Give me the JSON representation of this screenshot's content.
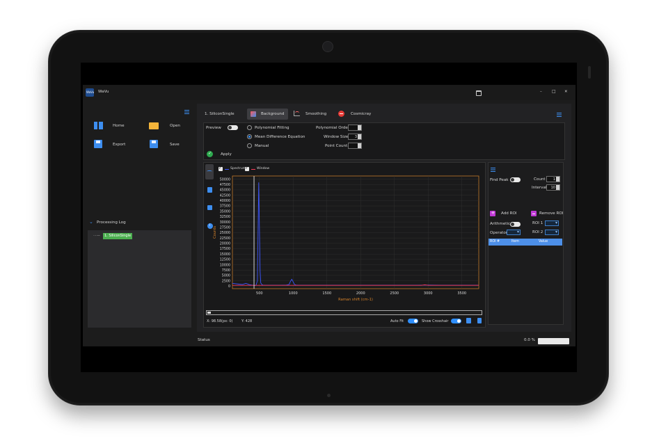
{
  "window": {
    "title": "WaVu",
    "logo_text": "WaVu",
    "minimize": "–",
    "maximize": "□",
    "close": "✕"
  },
  "sidebar": {
    "home": "Home",
    "open": "Open",
    "export": "Export",
    "save": "Save",
    "log_title": "Processing Log",
    "log_item": "1. SiliconSingle"
  },
  "toolbar": {
    "file_label": "1. SiliconSingle",
    "tab_background": "Background",
    "tab_smoothing": "Smoothing",
    "tab_cosmicray": "Cosmicray"
  },
  "settings": {
    "preview_label": "Preview",
    "radio_poly": "Polynomial Fitting",
    "radio_mean": "Mean Difference Equation",
    "radio_manual": "Manual",
    "poly_order_label": "Polynomial Order",
    "poly_order_value": "",
    "window_size_label": "Window Size",
    "window_size_value": "3",
    "point_count_label": "Point Count",
    "point_count_value": "",
    "apply_label": "Apply"
  },
  "plot": {
    "legend_spectrum": "Spectrum",
    "legend_window": "Window",
    "coord_x": "X: 98.58(px: 0)",
    "coord_y": "Y: 428",
    "auto_fit": "Auto Fit",
    "show_crosshair": "Show Crosshair",
    "colors": {
      "spectrum": "#3b55ff",
      "window_line": "#ff3b5b",
      "axes": "#c57a2a",
      "cursor": "#e8e8e8",
      "axis_label": "#d8832a"
    }
  },
  "chart_data": {
    "type": "line",
    "xlabel": "Raman shift (cm-1)",
    "ylabel": "Counts",
    "xlim": [
      100,
      3750
    ],
    "ylim": [
      -1200,
      51500
    ],
    "x_ticks": [
      500,
      1000,
      1500,
      2000,
      2500,
      3000,
      3500
    ],
    "y_ticks": [
      0,
      2500,
      5000,
      7500,
      10000,
      12500,
      15000,
      17500,
      20000,
      22500,
      25000,
      27500,
      30000,
      32500,
      35000,
      37500,
      40000,
      42500,
      45000,
      47500,
      50000
    ],
    "grid": true,
    "cursor_x": 420,
    "series": [
      {
        "name": "Spectrum",
        "x": [
          100,
          150,
          200,
          250,
          300,
          350,
          400,
          430,
          450,
          470,
          490,
          510,
          520,
          540,
          560,
          600,
          650,
          700,
          800,
          900,
          940,
          960,
          980,
          1000,
          1020,
          1040,
          1080,
          1200,
          1400,
          1600,
          1800,
          2000,
          2200,
          2400,
          2600,
          2800,
          3000,
          3200,
          3400,
          3600,
          3750
        ],
        "y": [
          1300,
          1100,
          900,
          800,
          1300,
          700,
          400,
          300,
          400,
          2500,
          48500,
          7000,
          1500,
          600,
          400,
          400,
          400,
          400,
          400,
          500,
          800,
          2200,
          3200,
          2000,
          800,
          500,
          400,
          400,
          400,
          400,
          400,
          400,
          400,
          400,
          400,
          400,
          500,
          400,
          400,
          400,
          400
        ]
      },
      {
        "name": "Window",
        "x": [
          100,
          500,
          1000,
          1500,
          2000,
          2500,
          2900,
          2950,
          3000,
          3500,
          3750
        ],
        "y": [
          350,
          350,
          360,
          360,
          350,
          350,
          360,
          600,
          360,
          350,
          350
        ]
      }
    ]
  },
  "peaks": {
    "find_peak": "Find Peak",
    "count_label": "Count",
    "count_value": "1",
    "interval_label": "Interval",
    "interval_value": "10",
    "add_roi": "Add ROI",
    "remove_roi": "Remove ROI",
    "arithmetic": "Arithmetic",
    "roi1": "ROI 1",
    "operator": "Operator",
    "roi2": "ROI 2",
    "table_headers": [
      "ROI #",
      "Item",
      "Value"
    ]
  },
  "status": {
    "label": "Status",
    "progress_text": "0.0 %",
    "progress": 0.0
  }
}
